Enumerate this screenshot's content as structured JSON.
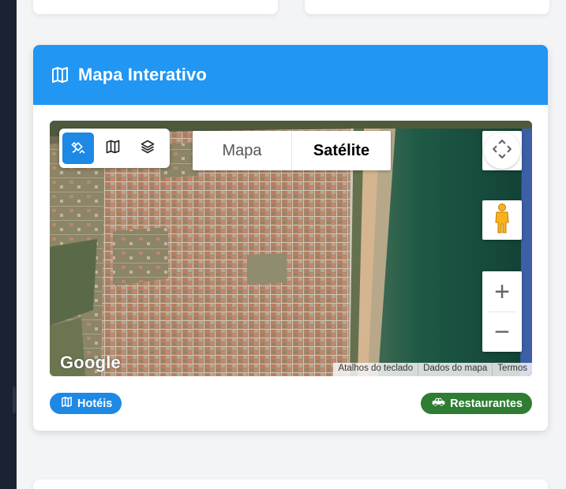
{
  "card": {
    "title": "Mapa Interativo",
    "header_color": "#2196f3",
    "title_icon": "map-icon"
  },
  "map": {
    "view": "satellite",
    "tools": [
      {
        "icon": "satellite-icon",
        "active": true
      },
      {
        "icon": "map-icon",
        "active": false
      },
      {
        "icon": "layers-icon",
        "active": false
      }
    ],
    "map_type": {
      "map_label": "Mapa",
      "satellite_label": "Satélite",
      "selected": "Satélite"
    },
    "logo": "Google",
    "attribution": {
      "shortcuts": "Atalhos do teclado",
      "data": "Dados do mapa",
      "terms": "Termos"
    },
    "zoom_in": "+",
    "zoom_out": "−"
  },
  "badges": {
    "hotels": {
      "label": "Hotéis",
      "icon": "map-icon",
      "color": "#1e88e5"
    },
    "restaurants": {
      "label": "Restaurantes",
      "icon": "car-icon",
      "color": "#2e7d32"
    }
  }
}
